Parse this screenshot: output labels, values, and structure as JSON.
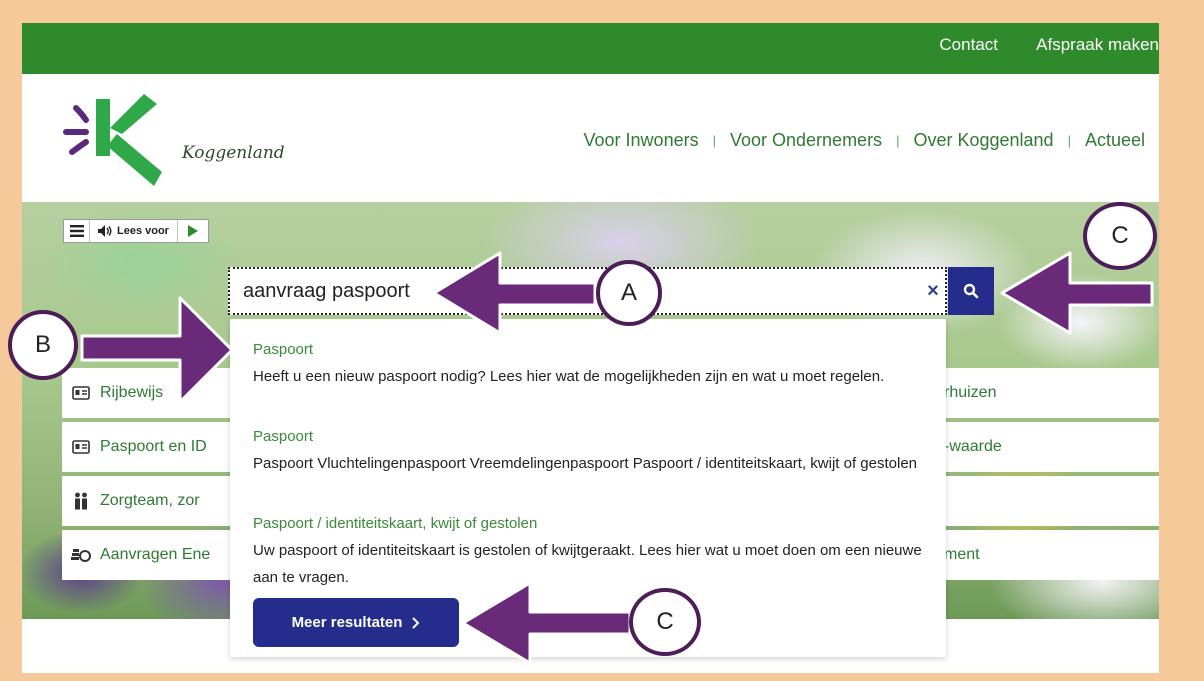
{
  "topbar": {
    "contact": "Contact",
    "afspraak": "Afspraak maken",
    "color": "#2f8a2c"
  },
  "logo": {
    "text": "Koggenland"
  },
  "nav": [
    {
      "label": "Voor Inwoners"
    },
    {
      "label": "Voor Ondernemers"
    },
    {
      "label": "Over Koggenland"
    },
    {
      "label": "Actueel"
    }
  ],
  "readspeaker": {
    "menu_icon": "hamburger-icon",
    "label": "Lees voor",
    "play_icon": "play-icon"
  },
  "search": {
    "value": "aanvraag paspoort",
    "clear": "×",
    "button_icon": "search-icon",
    "button_color": "#242c8c"
  },
  "tiles_left": [
    {
      "label": "Rijbewijs",
      "icon": "id-card-icon"
    },
    {
      "label": "Paspoort en ID",
      "icon": "id-card-icon"
    },
    {
      "label": "Zorgteam, zor",
      "icon": "people-icon"
    },
    {
      "label": "Aanvragen Ene",
      "icon": "money-icon"
    }
  ],
  "tiles_right": [
    {
      "label": "rhuizen"
    },
    {
      "label": "-waarde"
    },
    {
      "label": ""
    },
    {
      "label": "ment"
    }
  ],
  "results": [
    {
      "title": "Paspoort",
      "description": "Heeft u een nieuw paspoort nodig? Lees hier wat de mogelijkheden zijn en wat u moet regelen."
    },
    {
      "title": "Paspoort",
      "description": "Paspoort Vluchtelingenpaspoort Vreemdelingenpaspoort Paspoort / identiteitskaart, kwijt of gestolen"
    },
    {
      "title": "Paspoort / identiteitskaart, kwijt of gestolen",
      "description": "Uw paspoort of identiteitskaart is gestolen of kwijtgeraakt. Lees hier wat u moet doen om een nieuwe aan te vragen."
    }
  ],
  "more_results": {
    "label": "Meer resultaten",
    "icon": "chevron-right-icon"
  },
  "callouts": {
    "a": "A",
    "b": "B",
    "c1": "C",
    "c2": "C",
    "arrow_color": "#6a2a7a"
  }
}
